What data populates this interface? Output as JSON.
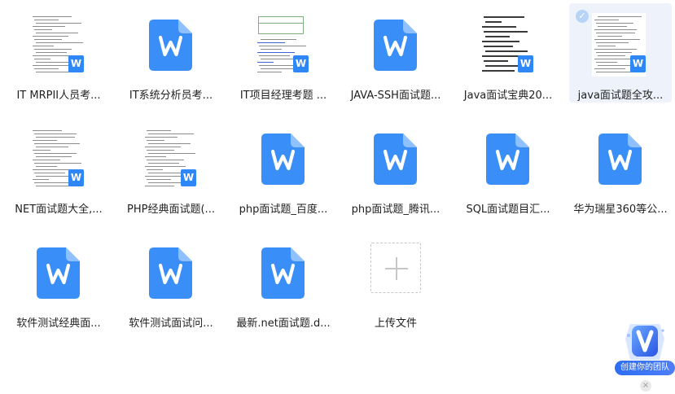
{
  "files": [
    {
      "name": "IT MRPII人员考...",
      "thumb": "doc"
    },
    {
      "name": "IT系统分析员考...",
      "thumb": "word-icon"
    },
    {
      "name": "IT项目经理考题 ...",
      "thumb": "doc-table"
    },
    {
      "name": "JAVA-SSH面试题...",
      "thumb": "word-icon"
    },
    {
      "name": "Java面试宝典20...",
      "thumb": "doc-dark"
    },
    {
      "name": "java面试题全攻...",
      "thumb": "doc",
      "selected": true
    },
    {
      "name": "NET面试题大全,...",
      "thumb": "doc"
    },
    {
      "name": "PHP经典面试题(...",
      "thumb": "doc"
    },
    {
      "name": "php面试题_百度...",
      "thumb": "word-icon"
    },
    {
      "name": "php面试题_腾讯...",
      "thumb": "word-icon"
    },
    {
      "name": "SQL面试题目汇...",
      "thumb": "word-icon"
    },
    {
      "name": "华为瑞星360等公...",
      "thumb": "word-icon"
    },
    {
      "name": "软件测试经典面...",
      "thumb": "word-icon"
    },
    {
      "name": "软件测试面试问...",
      "thumb": "word-icon"
    },
    {
      "name": "最新.net面试题.d...",
      "thumb": "word-icon"
    }
  ],
  "upload": {
    "label": "上传文件",
    "icon": "plus-icon"
  },
  "promo": {
    "label": "创建你的团队",
    "icon": "v-badge-icon",
    "close_icon": "close-icon"
  },
  "file_type_letter": "W",
  "colors": {
    "word_blue": "#2f86f6",
    "selected_bg": "#eef3fb",
    "promo_blue": "#2c6df2"
  }
}
